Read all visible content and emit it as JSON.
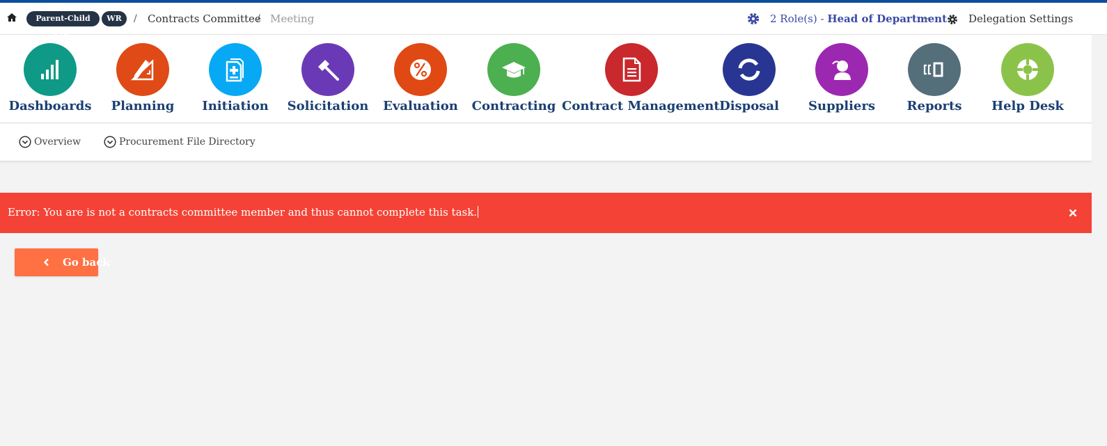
{
  "topbar": {
    "home_icon": "home-icon",
    "badges": [
      "Parent-Child PDE",
      "WR"
    ],
    "breadcrumb": [
      "Contracts Committee",
      "Meeting"
    ],
    "separator": "/",
    "roles": {
      "prefix": "2 Role(s) - ",
      "role": "Head of Department"
    },
    "delegation_label": "Delegation Settings",
    "accent_color": "#0b4f9c"
  },
  "modules": [
    {
      "label": "Dashboards",
      "color": "#0e9a86",
      "icon": "bar-chart-icon"
    },
    {
      "label": "Planning",
      "color": "#df4a16",
      "icon": "ruler-pencil-icon"
    },
    {
      "label": "Initiation",
      "color": "#07a9f4",
      "icon": "file-plus-icon"
    },
    {
      "label": "Solicitation",
      "color": "#6a3ab6",
      "icon": "gavel-icon"
    },
    {
      "label": "Evaluation",
      "color": "#e04814",
      "icon": "percent-icon"
    },
    {
      "label": "Contracting",
      "color": "#4caf50",
      "icon": "graduation-cap-icon"
    },
    {
      "label": "Contract Management",
      "color": "#c9282d",
      "icon": "document-icon"
    },
    {
      "label": "Disposal",
      "color": "#283593",
      "icon": "refresh-icon"
    },
    {
      "label": "Suppliers",
      "color": "#9c27b0",
      "icon": "user-icon"
    },
    {
      "label": "Reports",
      "color": "#546e7a",
      "icon": "report-icon"
    },
    {
      "label": "Help Desk",
      "color": "#8bc34a",
      "icon": "lifebuoy-icon"
    }
  ],
  "subnav": {
    "items": [
      "Overview",
      "Procurement File Directory"
    ]
  },
  "alert": {
    "message": "Error: You are is not a contracts committee member and thus cannot complete this task.",
    "color": "#f44336"
  },
  "back_button": {
    "label": "Go back",
    "color": "#ff7043"
  }
}
